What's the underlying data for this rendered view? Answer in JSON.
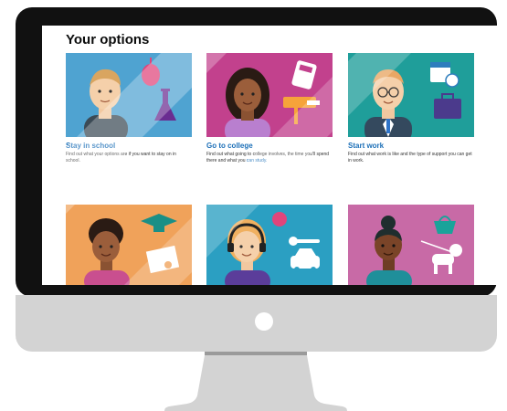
{
  "page": {
    "title": "Your options"
  },
  "cards": [
    {
      "title": "Stay in school",
      "description": "Find out what your options are if you want to stay on in school.",
      "image_bg": "#4fa3d1"
    },
    {
      "title": "Go to college",
      "description_before": "Find out what going to college involves, the time you'll spend there and what you ",
      "description_link": "can study.",
      "image_bg": "#c2418d"
    },
    {
      "title": "Start work",
      "description": "Find out what work is like and the type of support you can get in work.",
      "image_bg": "#1f9e9a"
    },
    {
      "title": "",
      "description": "",
      "image_bg": "#f0a25a"
    },
    {
      "title": "",
      "description": "",
      "image_bg": "#2b9fc2"
    },
    {
      "title": "",
      "description": "",
      "image_bg": "#c86aa6"
    }
  ],
  "icons": {
    "card1": [
      "student-avatar-icon",
      "mouse-icon",
      "flask-icon"
    ],
    "card2": [
      "student-avatar-icon",
      "calculator-icon",
      "paint-roller-icon"
    ],
    "card3": [
      "worker-avatar-icon",
      "calendar-clock-icon",
      "briefcase-icon"
    ],
    "card4": [
      "person-avatar-icon",
      "graduation-cap-icon",
      "certificate-icon"
    ],
    "card5": [
      "person-avatar-icon",
      "speech-bubble-icon",
      "wrench-icon",
      "car-icon"
    ],
    "card6": [
      "person-avatar-icon",
      "shopping-basket-icon",
      "dog-icon"
    ]
  },
  "colors": {
    "link_blue": "#1d70b8",
    "monitor_bezel": "#111111",
    "monitor_stand": "#d3d3d3"
  }
}
